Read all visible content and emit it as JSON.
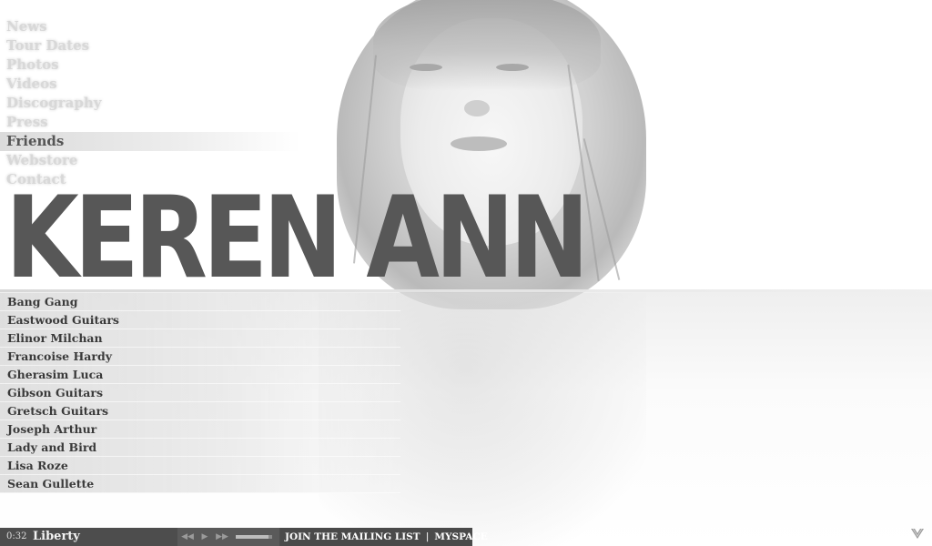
{
  "nav": {
    "items": [
      {
        "label": "News",
        "active": false
      },
      {
        "label": "Tour Dates",
        "active": false
      },
      {
        "label": "Photos",
        "active": false
      },
      {
        "label": "Videos",
        "active": false
      },
      {
        "label": "Discography",
        "active": false
      },
      {
        "label": "Press",
        "active": false
      },
      {
        "label": "Friends",
        "active": true
      },
      {
        "label": "Webstore",
        "active": false
      },
      {
        "label": "Contact",
        "active": false
      }
    ]
  },
  "title": "KEREN ANN",
  "friends": [
    "Bang Gang",
    "Eastwood Guitars",
    "Elinor Milchan",
    "Francoise Hardy",
    "Gherasim Luca",
    "Gibson Guitars",
    "Gretsch Guitars",
    "Joseph Arthur",
    "Lady and Bird",
    "Lisa Roze",
    "Sean Gullette"
  ],
  "player": {
    "time": "0:32",
    "track": "Liberty",
    "controls": {
      "prev_icon": "rewind-icon",
      "play_icon": "play-icon",
      "next_icon": "fast-forward-icon"
    },
    "volume_level": 0.9
  },
  "links": {
    "mailing_list": "JOIN THE MAILING LIST",
    "separator": "|",
    "myspace": "MYSPACE"
  },
  "colors": {
    "title": "#575757",
    "player_bg": "#4d4d4d",
    "nav_active": "#555555",
    "nav_inactive": "#d8d8d8"
  }
}
